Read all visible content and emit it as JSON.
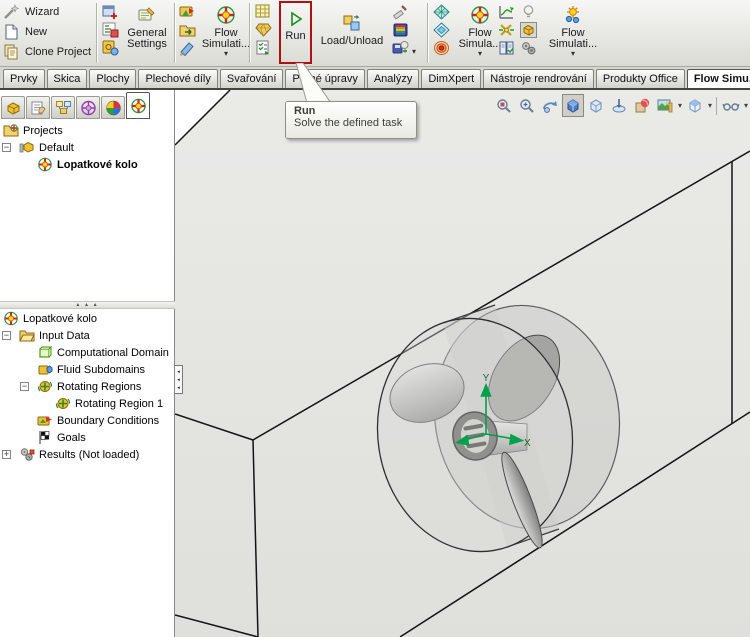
{
  "toolbar": {
    "wizard": "Wizard",
    "new": "New",
    "clone_project": "Clone Project",
    "general_settings": "General\nSettings",
    "flow_sim_button_1": "Flow\nSimulati...",
    "run": "Run",
    "load_unload": "Load/Unload",
    "flow_sim_button_2": "Flow\nSimula...",
    "flow_sim_button_3": "Flow\nSimulati...",
    "icon_columns": {
      "settings_stack": [
        "window-plus-icon",
        "component-tree-icon",
        "safe-icon"
      ],
      "project_stack": [
        "flag-plate-icon",
        "export-folder-icon",
        "paint-icon"
      ],
      "run_stack": [
        "grid-window-icon",
        "gem-icon",
        "checklist-icon"
      ],
      "results_stack": [
        "eraser-icon",
        "rainbow-disk-icon",
        "save-results-icon"
      ],
      "display_stack": [
        "mesh-diamond-icon",
        "mesh-diamond2-icon",
        "contour-rings-icon"
      ],
      "plot_stack": [
        "chart-arrow-icon",
        "section-x-icon",
        "report-book-icon"
      ],
      "tools_stack": [
        "lightbulb-icon",
        "part-button-icon",
        "gears-icon"
      ]
    }
  },
  "tabs": [
    {
      "label": "Prvky",
      "active": false
    },
    {
      "label": "Skica",
      "active": false
    },
    {
      "label": "Plochy",
      "active": false
    },
    {
      "label": "Plechové díly",
      "active": false
    },
    {
      "label": "Svařování",
      "active": false
    },
    {
      "label": "Přímé úpravy",
      "active": false
    },
    {
      "label": "Analýzy",
      "active": false
    },
    {
      "label": "DimXpert",
      "active": false
    },
    {
      "label": "Nástroje rendrování",
      "active": false
    },
    {
      "label": "Produkty Office",
      "active": false
    },
    {
      "label": "Flow Simu...",
      "active": true
    }
  ],
  "sidebar": {
    "panel_tabs": [
      "feature-manager-icon",
      "property-manager-icon",
      "configuration-manager-icon",
      "dimxpert-manager-icon",
      "display-manager-icon",
      "flow-simulation-tree-icon"
    ],
    "projects_tree": [
      {
        "label": "Projects",
        "icon": "projects-folder-icon",
        "level": 0,
        "expander": null,
        "bold": false
      },
      {
        "label": "Default",
        "icon": "default-project-icon",
        "level": 1,
        "expander": "minus",
        "bold": false
      },
      {
        "label": "Lopatkové kolo",
        "icon": "flow-project-icon",
        "level": 2,
        "expander": null,
        "bold": true
      }
    ],
    "analysis_tree": [
      {
        "label": "Lopatkové kolo",
        "icon": "flow-root-icon",
        "level": 0,
        "expander": null,
        "bold": false
      },
      {
        "label": "Input Data",
        "icon": "input-data-folder-icon",
        "level": 1,
        "expander": "minus",
        "bold": false
      },
      {
        "label": "Computational Domain",
        "icon": "computational-domain-icon",
        "level": 2,
        "expander": null,
        "bold": false
      },
      {
        "label": "Fluid Subdomains",
        "icon": "fluid-subdomains-icon",
        "level": 2,
        "expander": null,
        "bold": false
      },
      {
        "label": "Rotating Regions",
        "icon": "rotating-region-icon",
        "level": 2,
        "expander": "minus",
        "bold": false
      },
      {
        "label": "Rotating Region 1",
        "icon": "rotating-region-icon",
        "level": 3,
        "expander": null,
        "bold": false
      },
      {
        "label": "Boundary Conditions",
        "icon": "boundary-conditions-icon",
        "level": 2,
        "expander": null,
        "bold": false
      },
      {
        "label": "Goals",
        "icon": "goals-flag-icon",
        "level": 2,
        "expander": null,
        "bold": false
      },
      {
        "label": "Results (Not loaded)",
        "icon": "results-icon",
        "level": 1,
        "expander": "plus",
        "bold": false
      }
    ]
  },
  "hud": [
    "zoom-fit-icon",
    "zoom-area-icon",
    "rotate-view-icon",
    "shaded-cube-icon",
    "wireframe-cube-icon",
    "section-view-icon",
    "appearances-icon",
    "scene-icon",
    "view-orientation-icon",
    "glasses-icon"
  ],
  "tooltip": {
    "title": "Run",
    "text": "Solve the defined task"
  },
  "viewport": {
    "axis_y_label": "Y",
    "axis_x_label": "X"
  },
  "colors": {
    "highlight_red": "#b01010",
    "triad_green": "#00a850"
  }
}
